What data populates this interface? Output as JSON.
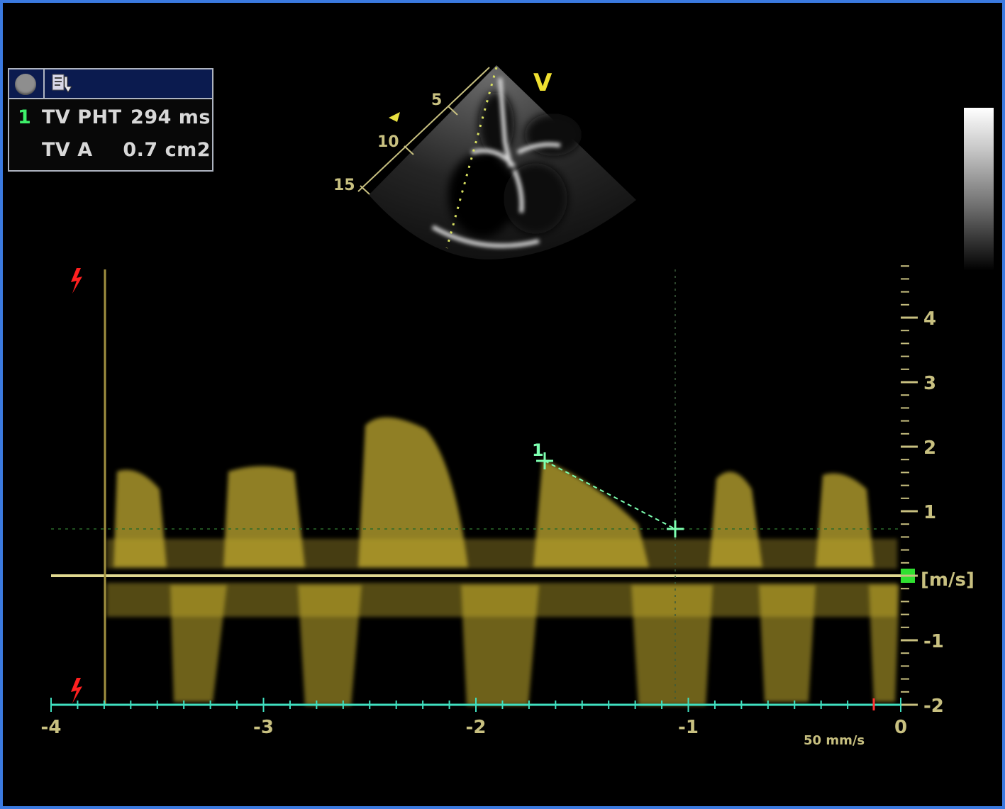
{
  "measurements": [
    {
      "index": "1",
      "label": "TV PHT",
      "value": "294 ms"
    },
    {
      "index": "",
      "label": "TV A",
      "value": "0.7 cm2"
    }
  ],
  "view_marker": "V",
  "depth_labels": [
    "5",
    "10",
    "15"
  ],
  "velocity_axis": {
    "unit": "[m/s]",
    "ticks": [
      {
        "label": "4",
        "value": 4
      },
      {
        "label": "3",
        "value": 3
      },
      {
        "label": "2",
        "value": 2
      },
      {
        "label": "1",
        "value": 1
      },
      {
        "label": "-1",
        "value": -1
      },
      {
        "label": "-2",
        "value": -2
      }
    ]
  },
  "time_axis": {
    "ticks": [
      {
        "label": "-4",
        "value": -4
      },
      {
        "label": "-3",
        "value": -3
      },
      {
        "label": "-2",
        "value": -2
      },
      {
        "label": "-1",
        "value": -1
      },
      {
        "label": "0",
        "value": 0
      }
    ]
  },
  "sweep_speed": "50 mm/s",
  "caliper_label": "1",
  "colors": {
    "border": "#3b7ae0",
    "doppler": "#c8b030",
    "caliper": "#7dffb0",
    "measurement_index": "#3ef06a",
    "ecg_marker": "#ff2020",
    "time_axis": "#40e0c0",
    "header": "#0b1b4f"
  },
  "icons": [
    "record-icon",
    "report-icon",
    "ecg-trigger-icon"
  ]
}
